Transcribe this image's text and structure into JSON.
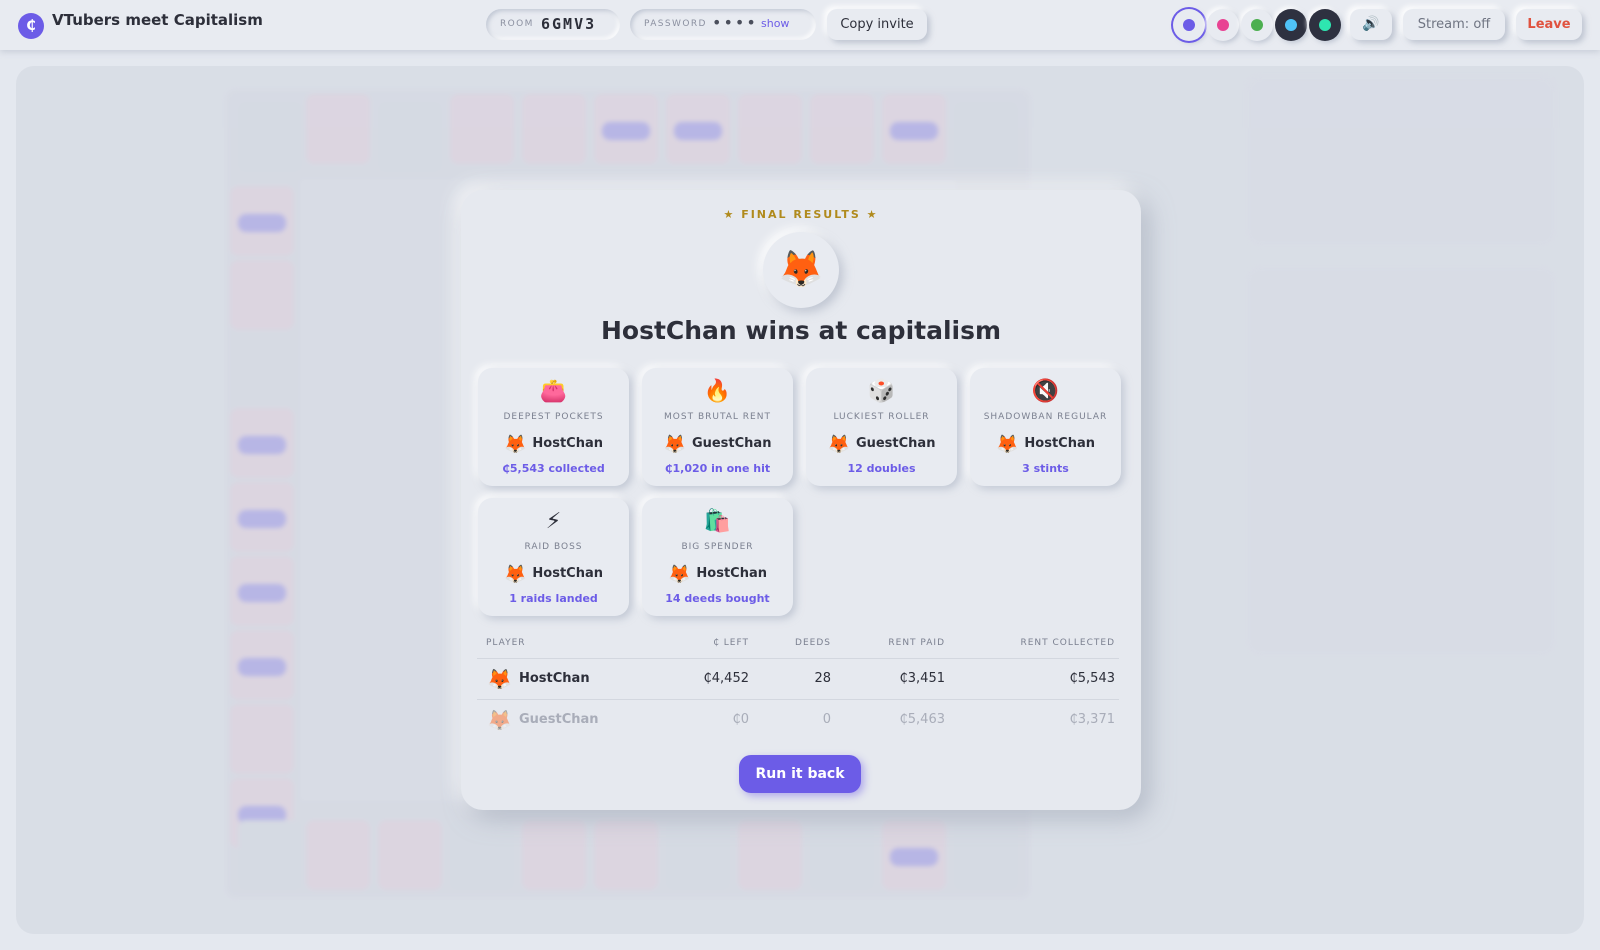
{
  "app": {
    "logo": "₵",
    "title": "VTubers meet Capitalism"
  },
  "room": {
    "label": "ROOM",
    "code": "6GMV3"
  },
  "password": {
    "label": "PASSWORD",
    "mask": "••••",
    "show_label": "show"
  },
  "copy_invite_label": "Copy invite",
  "avatar_colors": [
    "#6c5ce7",
    "#e84393",
    "#4caf50",
    "#4fc3f7",
    "#2ee6b0"
  ],
  "sound_icon": "speaker-icon",
  "stream_label": "Stream: off",
  "leave_label": "Leave",
  "results": {
    "kicker": "★ FINAL RESULTS ★",
    "winner_avatar": "🦊",
    "headline": "HostChan wins at capitalism",
    "awards": [
      {
        "icon": "👛",
        "icon_name": "purse-icon",
        "title": "DEEPEST POCKETS",
        "player": "HostChan",
        "stat": "₵5,543 collected"
      },
      {
        "icon": "🔥",
        "icon_name": "fire-icon",
        "title": "MOST BRUTAL RENT",
        "player": "GuestChan",
        "stat": "₵1,020 in one hit"
      },
      {
        "icon": "🎲",
        "icon_name": "dice-icon",
        "title": "LUCKIEST ROLLER",
        "player": "GuestChan",
        "stat": "12 doubles"
      },
      {
        "icon": "🔇",
        "icon_name": "muted-speaker-icon",
        "title": "SHADOWBAN REGULAR",
        "player": "HostChan",
        "stat": "3 stints"
      },
      {
        "icon": "⚡",
        "icon_name": "lightning-icon",
        "title": "RAID BOSS",
        "player": "HostChan",
        "stat": "1 raids landed"
      },
      {
        "icon": "🛍️",
        "icon_name": "shopping-bags-icon",
        "title": "BIG SPENDER",
        "player": "HostChan",
        "stat": "14 deeds bought"
      }
    ],
    "table": {
      "headers": {
        "player": "PLAYER",
        "left": "₵ LEFT",
        "deeds": "DEEDS",
        "rent_paid": "RENT PAID",
        "rent_collected": "RENT COLLECTED"
      },
      "rows": [
        {
          "avatar": "🦊",
          "player": "HostChan",
          "left": "₵4,452",
          "deeds": "28",
          "rent_paid": "₵3,451",
          "rent_collected": "₵5,543"
        },
        {
          "avatar": "🦊",
          "player": "GuestChan",
          "left": "₵0",
          "deeds": "0",
          "rent_paid": "₵5,463",
          "rent_collected": "₵3,371"
        }
      ]
    },
    "run_back_label": "Run it back"
  }
}
